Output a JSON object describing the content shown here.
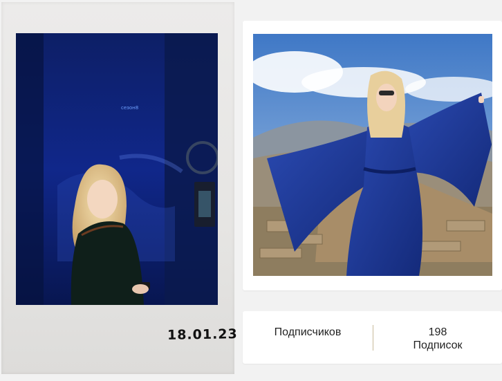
{
  "gallery": {
    "polaroid": {
      "date_text": "18.01.23",
      "screen_text": "сезон8"
    },
    "photo": {
      "subject": "woman in blue dress"
    }
  },
  "stats": {
    "followers": {
      "label": "Подписчиков",
      "count": ""
    },
    "following": {
      "count": "198",
      "label": "Подписок"
    }
  },
  "colors": {
    "background": "#f2f2f2",
    "card": "#ffffff",
    "divider": "#c7b99a",
    "dress_blue": "#1e3a9a",
    "sky_blue": "#4d7fc8"
  }
}
